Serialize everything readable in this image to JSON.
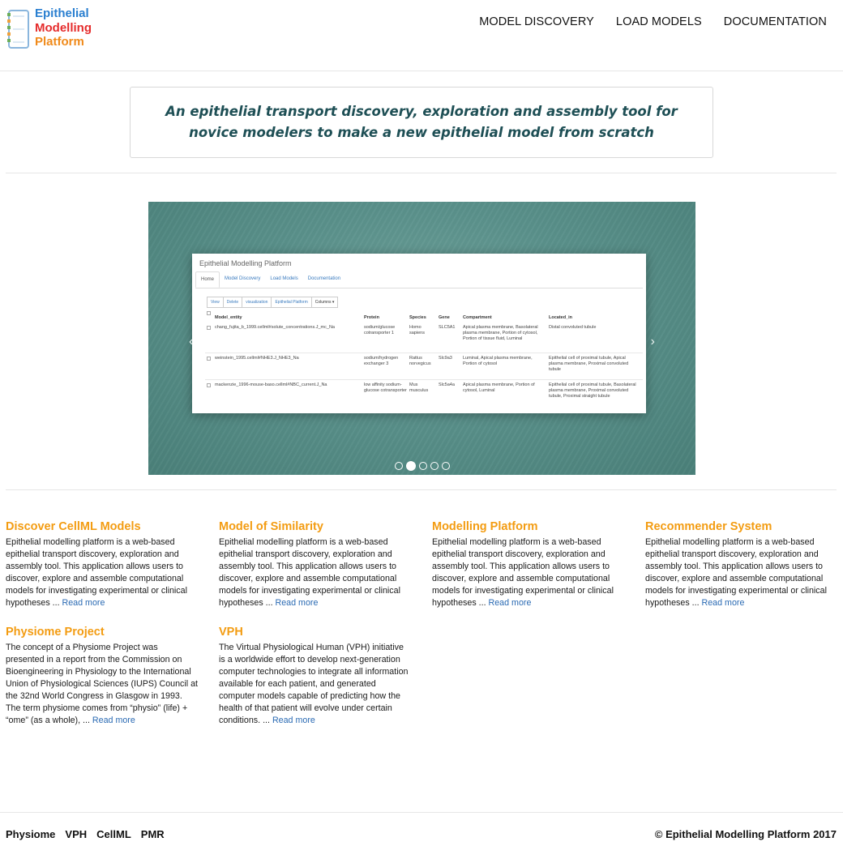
{
  "brand": {
    "line1": "Epithelial",
    "line2": "Modelling",
    "line3": "Platform",
    "colors": {
      "line1": "#2a7fd0",
      "line2": "#e52c2c",
      "line3": "#f08a1a"
    }
  },
  "nav": {
    "items": [
      {
        "label": "MODEL DISCOVERY"
      },
      {
        "label": "LOAD MODELS"
      },
      {
        "label": "DOCUMENTATION"
      }
    ]
  },
  "tagline": "An epithelial transport discovery, exploration and assembly tool for novice modelers to make a new epithelial model from scratch",
  "carousel": {
    "prev_icon": "‹",
    "next_icon": "›",
    "active_index": 1,
    "slide_count": 5,
    "slide": {
      "app_title": "Epithelial Modelling Platform",
      "tabs": [
        "Home",
        "Model Discovery",
        "Load Models",
        "Documentation"
      ],
      "toolbar": [
        "View",
        "Delete",
        "visualization",
        "Epithelial Platform",
        "Columns ▾"
      ],
      "headers": [
        "Model_entity",
        "Protein",
        "Species",
        "Gene",
        "Compartment",
        "Located_in"
      ],
      "rows": [
        {
          "model": "chang_fujita_b_1999.cellml#solute_concentrations.J_mc_Na",
          "protein": "sodium/glucose cotransporter 1",
          "species": "Homo sapiens",
          "gene": "SLC5A1",
          "compartment": "Apical plasma membrane, Basolateral plasma membrane, Portion of cytosol, Portion of tissue fluid, Luminal",
          "located": "Distal convoluted tubule"
        },
        {
          "model": "weinstein_1995.cellml#NHE3.J_NHE3_Na",
          "protein": "sodium/hydrogen exchanger 3",
          "species": "Rattus norvegicus",
          "gene": "Slc9a3",
          "compartment": "Luminal, Apical plasma membrane, Portion of cytosol",
          "located": "Epithelial cell of proximal tubule, Apical plasma membrane, Proximal convoluted tubule"
        },
        {
          "model": "mackenzie_1996-mouse-baso.cellml#NBC_current.J_Na",
          "protein": "low affinity sodium-glucose cotransporter",
          "species": "Mus musculus",
          "gene": "Slc5a4a",
          "compartment": "Apical plasma membrane, Portion of cytosol, Luminal",
          "located": "Epithelial cell of proximal tubule, Basolateral plasma membrane, Proximal convoluted tubule, Proximal straight tubule"
        }
      ]
    }
  },
  "articles": [
    {
      "title": "Discover CellML Models",
      "body": "Epithelial modelling platform is a web-based epithelial transport discovery, exploration and assembly tool. This application allows users to discover, explore and assemble computational models for investigating experimental or clinical hypotheses ... ",
      "link": "Read more"
    },
    {
      "title": "Model of Similarity",
      "body": "Epithelial modelling platform is a web-based epithelial transport discovery, exploration and assembly tool. This application allows users to discover, explore and assemble computational models for investigating experimental or clinical hypotheses ... ",
      "link": "Read more"
    },
    {
      "title": "Modelling Platform",
      "body": "Epithelial modelling platform is a web-based epithelial transport discovery, exploration and assembly tool. This application allows users to discover, explore and assemble computational models for investigating experimental or clinical hypotheses ... ",
      "link": "Read more"
    },
    {
      "title": "Recommender System",
      "body": "Epithelial modelling platform is a web-based epithelial transport discovery, exploration and assembly tool. This application allows users to discover, explore and assemble computational models for investigating experimental or clinical hypotheses ... ",
      "link": "Read more"
    },
    {
      "title": "Physiome Project",
      "body": "The concept of a Physiome Project was presented in a report from the Commission on Bioengineering in Physiology to the International Union of Physiological Sciences (IUPS) Council at the 32nd World Congress in Glasgow in 1993. The term physiome comes from “physio” (life) + “ome” (as a whole), ... ",
      "link": "Read more"
    },
    {
      "title": "VPH",
      "body": "The Virtual Physiological Human (VPH) initiative is a worldwide effort to develop next-generation computer technologies to integrate all information available for each patient, and generated computer models capable of predicting how the health of that patient will evolve under certain conditions. ... ",
      "link": "Read more"
    }
  ],
  "footer": {
    "links": [
      "Physiome",
      "VPH",
      "CellML",
      "PMR"
    ],
    "copyright": "© Epithelial Modelling Platform 2017"
  },
  "colors": {
    "article_title": "#f39c12",
    "link": "#2a6ab3",
    "tagline": "#1e4f55",
    "carousel_bg": "#5a918b"
  }
}
